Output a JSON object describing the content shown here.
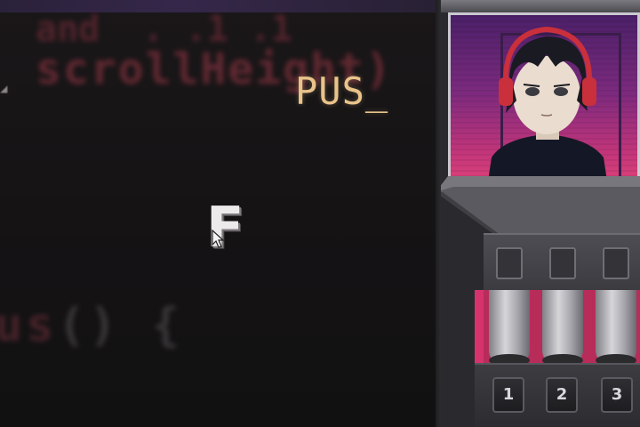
{
  "game": {
    "typed_word": "PUS",
    "cursor": "_",
    "falling_letter": "F"
  },
  "code_backdrop": {
    "line1": "and  . .1 .1",
    "line2": "scrollHeight)",
    "line3_left": "us",
    "line3_right": "() {"
  },
  "machine": {
    "keys": [
      {
        "label": "1"
      },
      {
        "label": "2"
      },
      {
        "label": "3"
      }
    ]
  },
  "colors": {
    "typed_word": "#e9c48a",
    "monitor_top": "#4b2068",
    "monitor_bottom": "#e04479",
    "tube_band": "#b82c5a",
    "background": "#141314"
  },
  "icons": {
    "pointer": "mouse-pointer-icon",
    "headphones": "headphones-icon"
  }
}
